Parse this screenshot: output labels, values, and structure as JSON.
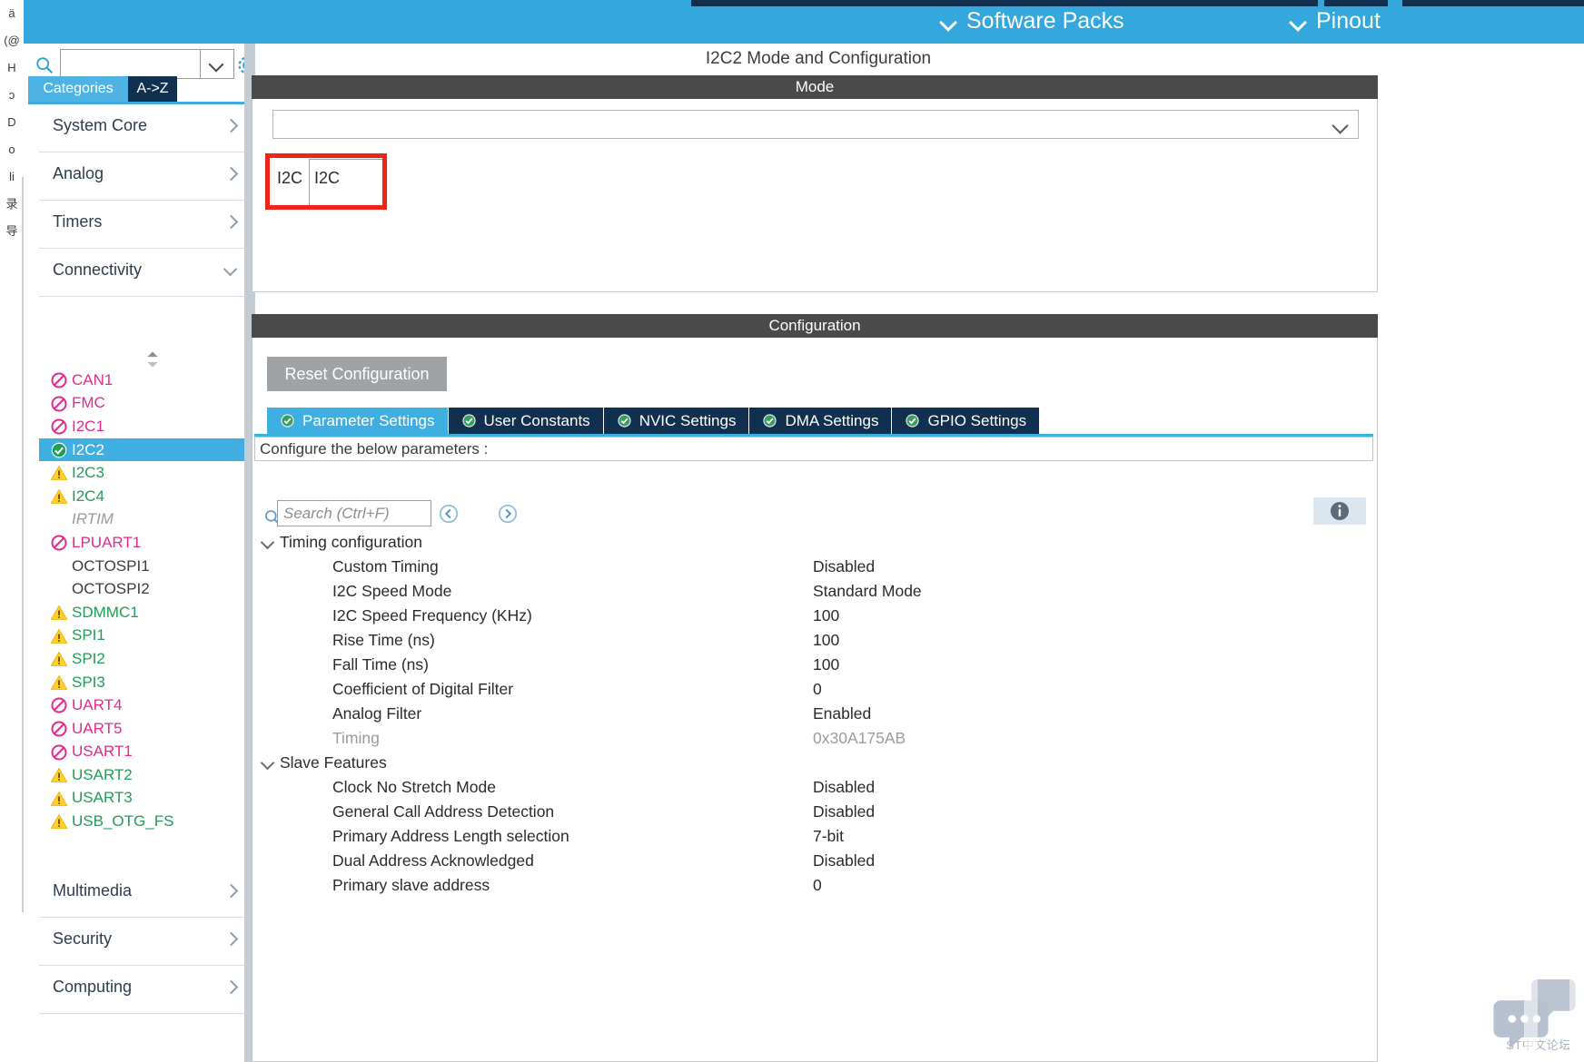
{
  "topbar": {
    "software_packs": "Software Packs",
    "pinout": "Pinout"
  },
  "sidebar": {
    "search": {
      "value": "",
      "placeholder": ""
    },
    "tabs": [
      {
        "label": "Categories",
        "active": true
      },
      {
        "label": "A->Z",
        "active": false
      }
    ],
    "categories_top": [
      {
        "label": "System Core",
        "expanded": false
      },
      {
        "label": "Analog",
        "expanded": false
      },
      {
        "label": "Timers",
        "expanded": false
      },
      {
        "label": "Connectivity",
        "expanded": true
      }
    ],
    "peripherals": [
      {
        "label": "CAN1",
        "status": "forbidden",
        "color": "pink",
        "selected": false
      },
      {
        "label": "FMC",
        "status": "forbidden",
        "color": "pink",
        "selected": false
      },
      {
        "label": "I2C1",
        "status": "forbidden",
        "color": "pink",
        "selected": false
      },
      {
        "label": "I2C2",
        "status": "ok",
        "color": "white",
        "selected": true
      },
      {
        "label": "I2C3",
        "status": "warning",
        "color": "green",
        "selected": false
      },
      {
        "label": "I2C4",
        "status": "warning",
        "color": "green",
        "selected": false
      },
      {
        "label": "IRTIM",
        "status": "none",
        "color": "grey",
        "selected": false
      },
      {
        "label": "LPUART1",
        "status": "forbidden",
        "color": "pink",
        "selected": false
      },
      {
        "label": "OCTOSPI1",
        "status": "none",
        "color": "dark",
        "selected": false
      },
      {
        "label": "OCTOSPI2",
        "status": "none",
        "color": "dark",
        "selected": false
      },
      {
        "label": "SDMMC1",
        "status": "warning",
        "color": "green",
        "selected": false
      },
      {
        "label": "SPI1",
        "status": "warning",
        "color": "green",
        "selected": false
      },
      {
        "label": "SPI2",
        "status": "warning",
        "color": "green",
        "selected": false
      },
      {
        "label": "SPI3",
        "status": "warning",
        "color": "green",
        "selected": false
      },
      {
        "label": "UART4",
        "status": "forbidden",
        "color": "pink",
        "selected": false
      },
      {
        "label": "UART5",
        "status": "forbidden",
        "color": "pink",
        "selected": false
      },
      {
        "label": "USART1",
        "status": "forbidden",
        "color": "pink",
        "selected": false
      },
      {
        "label": "USART2",
        "status": "warning",
        "color": "green",
        "selected": false
      },
      {
        "label": "USART3",
        "status": "warning",
        "color": "green",
        "selected": false
      },
      {
        "label": "USB_OTG_FS",
        "status": "warning",
        "color": "green",
        "selected": false
      }
    ],
    "categories_bottom": [
      {
        "label": "Multimedia",
        "expanded": false
      },
      {
        "label": "Security",
        "expanded": false
      },
      {
        "label": "Computing",
        "expanded": false
      }
    ]
  },
  "main": {
    "title": "I2C2 Mode and Configuration",
    "mode_header": "Mode",
    "mode": {
      "label": "I2C",
      "value": "I2C"
    },
    "config_header": "Configuration",
    "reset_button": "Reset Configuration",
    "tabs": [
      {
        "label": "Parameter Settings",
        "active": true
      },
      {
        "label": "User Constants",
        "active": false
      },
      {
        "label": "NVIC Settings",
        "active": false
      },
      {
        "label": "DMA Settings",
        "active": false
      },
      {
        "label": "GPIO Settings",
        "active": false
      }
    ],
    "configure_note": "Configure the below parameters :",
    "param_search": {
      "value": "",
      "placeholder": "Search (Ctrl+F)"
    },
    "param_groups": [
      {
        "label": "Timing configuration",
        "expanded": true,
        "rows": [
          {
            "name": "Custom Timing",
            "value": "Disabled",
            "dim": false
          },
          {
            "name": "I2C Speed Mode",
            "value": "Standard Mode",
            "dim": false
          },
          {
            "name": "I2C Speed Frequency (KHz)",
            "value": "100",
            "dim": false
          },
          {
            "name": "Rise Time (ns)",
            "value": "100",
            "dim": false
          },
          {
            "name": "Fall Time (ns)",
            "value": "100",
            "dim": false
          },
          {
            "name": "Coefficient of Digital Filter",
            "value": "0",
            "dim": false
          },
          {
            "name": "Analog Filter",
            "value": "Enabled",
            "dim": false
          },
          {
            "name": "Timing",
            "value": "0x30A175AB",
            "dim": true
          }
        ]
      },
      {
        "label": "Slave Features",
        "expanded": true,
        "rows": [
          {
            "name": "Clock No Stretch Mode",
            "value": "Disabled",
            "dim": false
          },
          {
            "name": "General Call Address Detection",
            "value": "Disabled",
            "dim": false
          },
          {
            "name": "Primary Address Length selection",
            "value": "7-bit",
            "dim": false
          },
          {
            "name": "Dual Address Acknowledged",
            "value": "Disabled",
            "dim": false
          },
          {
            "name": "Primary slave address",
            "value": "0",
            "dim": false
          }
        ]
      }
    ]
  },
  "ghost_column": [
    "ä",
    "(@",
    "H",
    "ɔ",
    "D",
    "o",
    "",
    "",
    "",
    "",
    "",
    "",
    "",
    "",
    "",
    "",
    "",
    "",
    "",
    "",
    "",
    "",
    "",
    "",
    "",
    "li",
    "",
    "录",
    "",
    "",
    "导"
  ],
  "watermark": {
    "text": "ST中文论坛"
  },
  "colors": {
    "brand_blue": "#34a7dc",
    "navy": "#11304f",
    "selected_blue": "#3fafe2",
    "header_grey": "#4a4a4a",
    "pink": "#e32a8c",
    "green": "#1f9d55",
    "warning_yellow": "#ffcf2b",
    "highlight_red": "#f02315"
  }
}
